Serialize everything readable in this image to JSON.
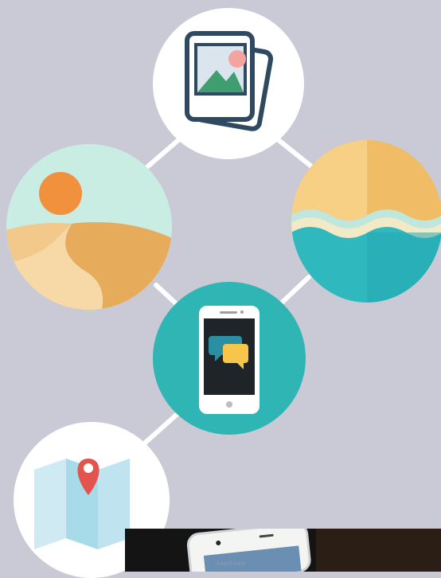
{
  "scene": {
    "background": "#c9cad6",
    "connector_color": "#ffffff"
  },
  "nodes": [
    {
      "name": "gallery-node",
      "icon": "photo-gallery-icon",
      "fill": "#ffffff"
    },
    {
      "name": "desert-node",
      "icon": "desert-dune-icon",
      "fill": "#c9ece3"
    },
    {
      "name": "ocean-node",
      "icon": "ocean-wave-icon",
      "fill": "#f4c776"
    },
    {
      "name": "messaging-node",
      "icon": "smartphone-chat-icon",
      "fill": "#2fb5b3"
    },
    {
      "name": "map-node",
      "icon": "map-pin-icon",
      "fill": "#ffffff"
    }
  ],
  "photo_inset": {
    "brand_text": "SAMSUNG"
  }
}
